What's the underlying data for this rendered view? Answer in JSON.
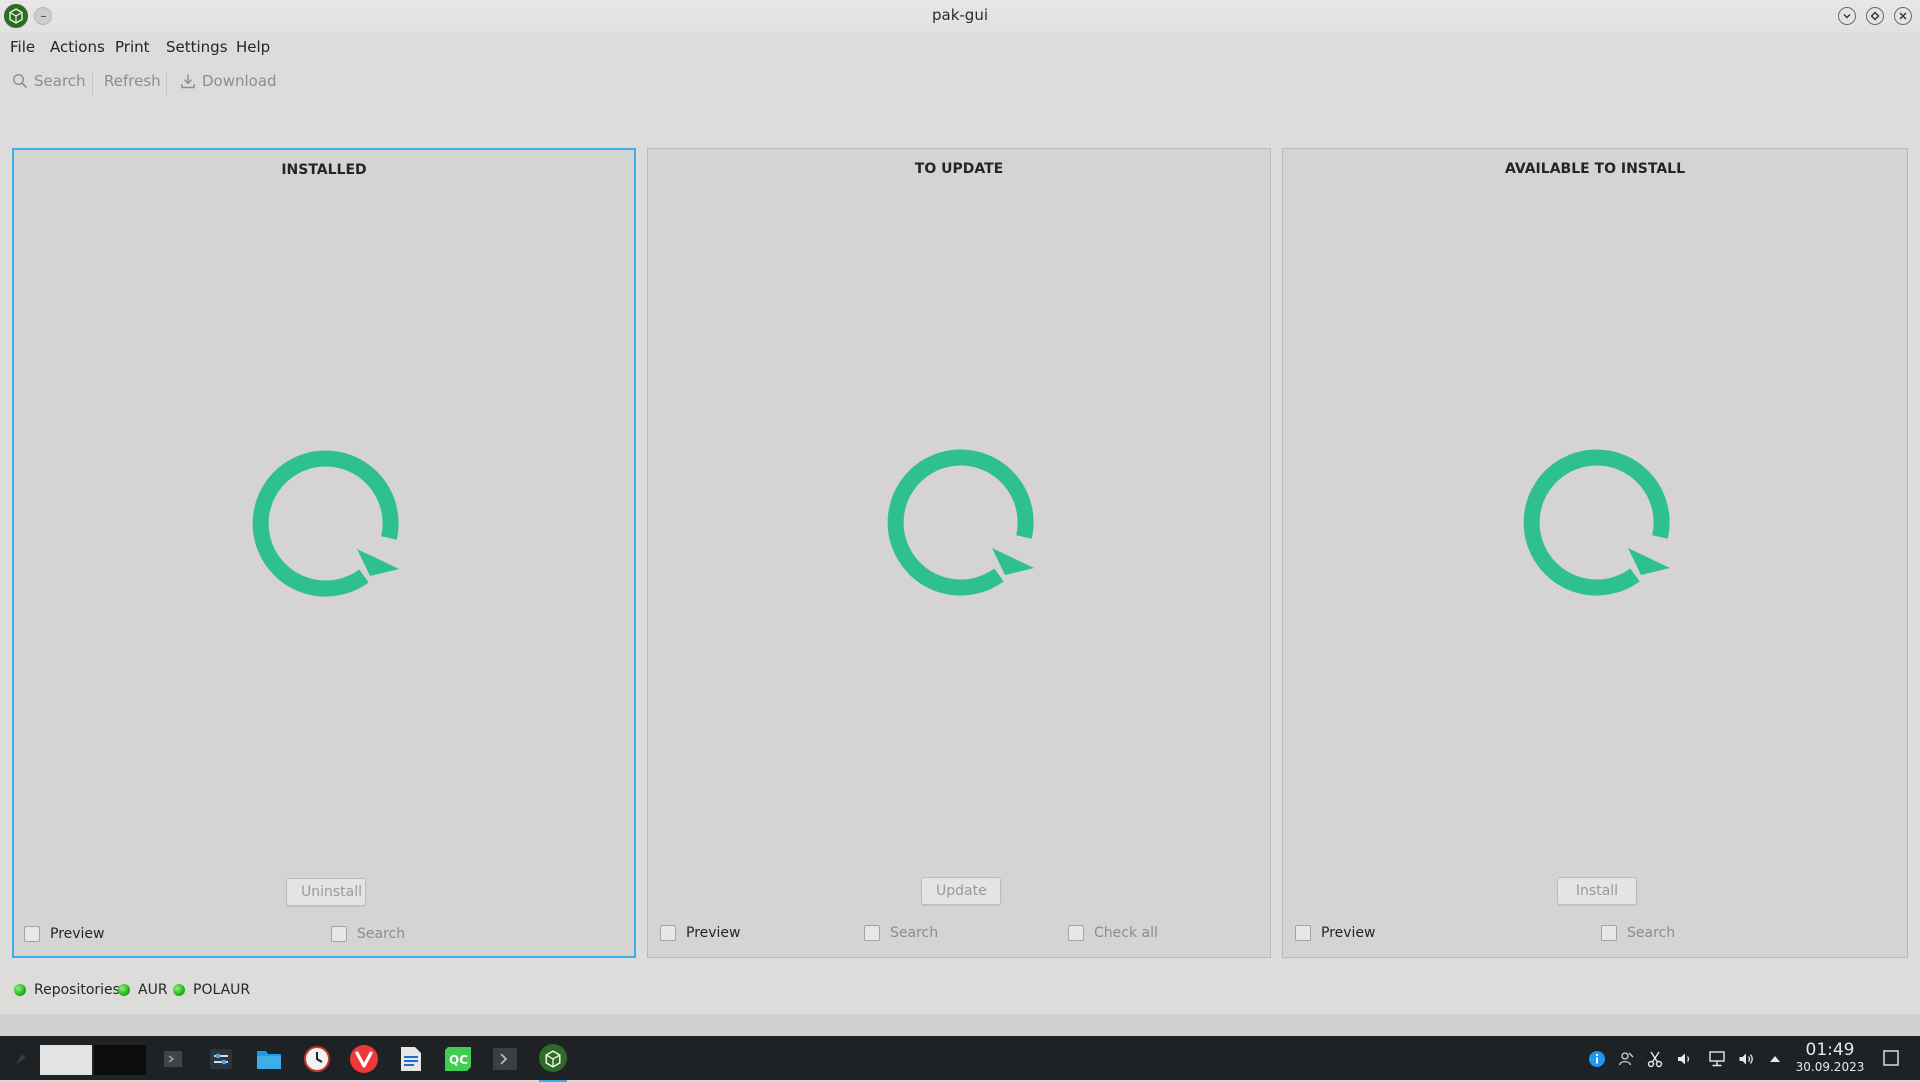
{
  "window": {
    "title": "pak-gui"
  },
  "menu": {
    "items": [
      "File",
      "Actions",
      "Print",
      "Settings",
      "Help"
    ]
  },
  "toolbar": {
    "search": "Search",
    "refresh": "Refresh",
    "download": "Download"
  },
  "panels": [
    {
      "title": "INSTALLED",
      "action": "Uninstall",
      "preview": "Preview",
      "search": "Search"
    },
    {
      "title": "TO UPDATE",
      "action": "Update",
      "preview": "Preview",
      "search": "Search",
      "check_all": "Check all"
    },
    {
      "title": "AVAILABLE TO INSTALL",
      "action": "Install",
      "preview": "Preview",
      "search": "Search"
    }
  ],
  "status": {
    "repositories": "Repositories",
    "aur": "AUR",
    "polaur": "POLAUR",
    "indicator_color": "#22b41e"
  },
  "taskbar": {
    "apps": [
      "app-launcher-icon",
      "pager-icon",
      "terminal-icon",
      "system-settings-icon",
      "file-manager-icon",
      "clock-app-icon",
      "vivaldi-icon",
      "libreoffice-writer-icon",
      "qt-creator-icon",
      "console-icon",
      "pak-gui-icon"
    ],
    "tray": [
      "info-icon",
      "accounts-icon",
      "clipboard-icon",
      "audio-icon",
      "network-icon",
      "volume-icon",
      "tray-expand-icon"
    ]
  },
  "clock": {
    "time": "01:49",
    "date": "30.09.2023"
  },
  "colors": {
    "accent": "#3daee9",
    "spinner": "#2ec08f",
    "background": "#dedcda"
  }
}
